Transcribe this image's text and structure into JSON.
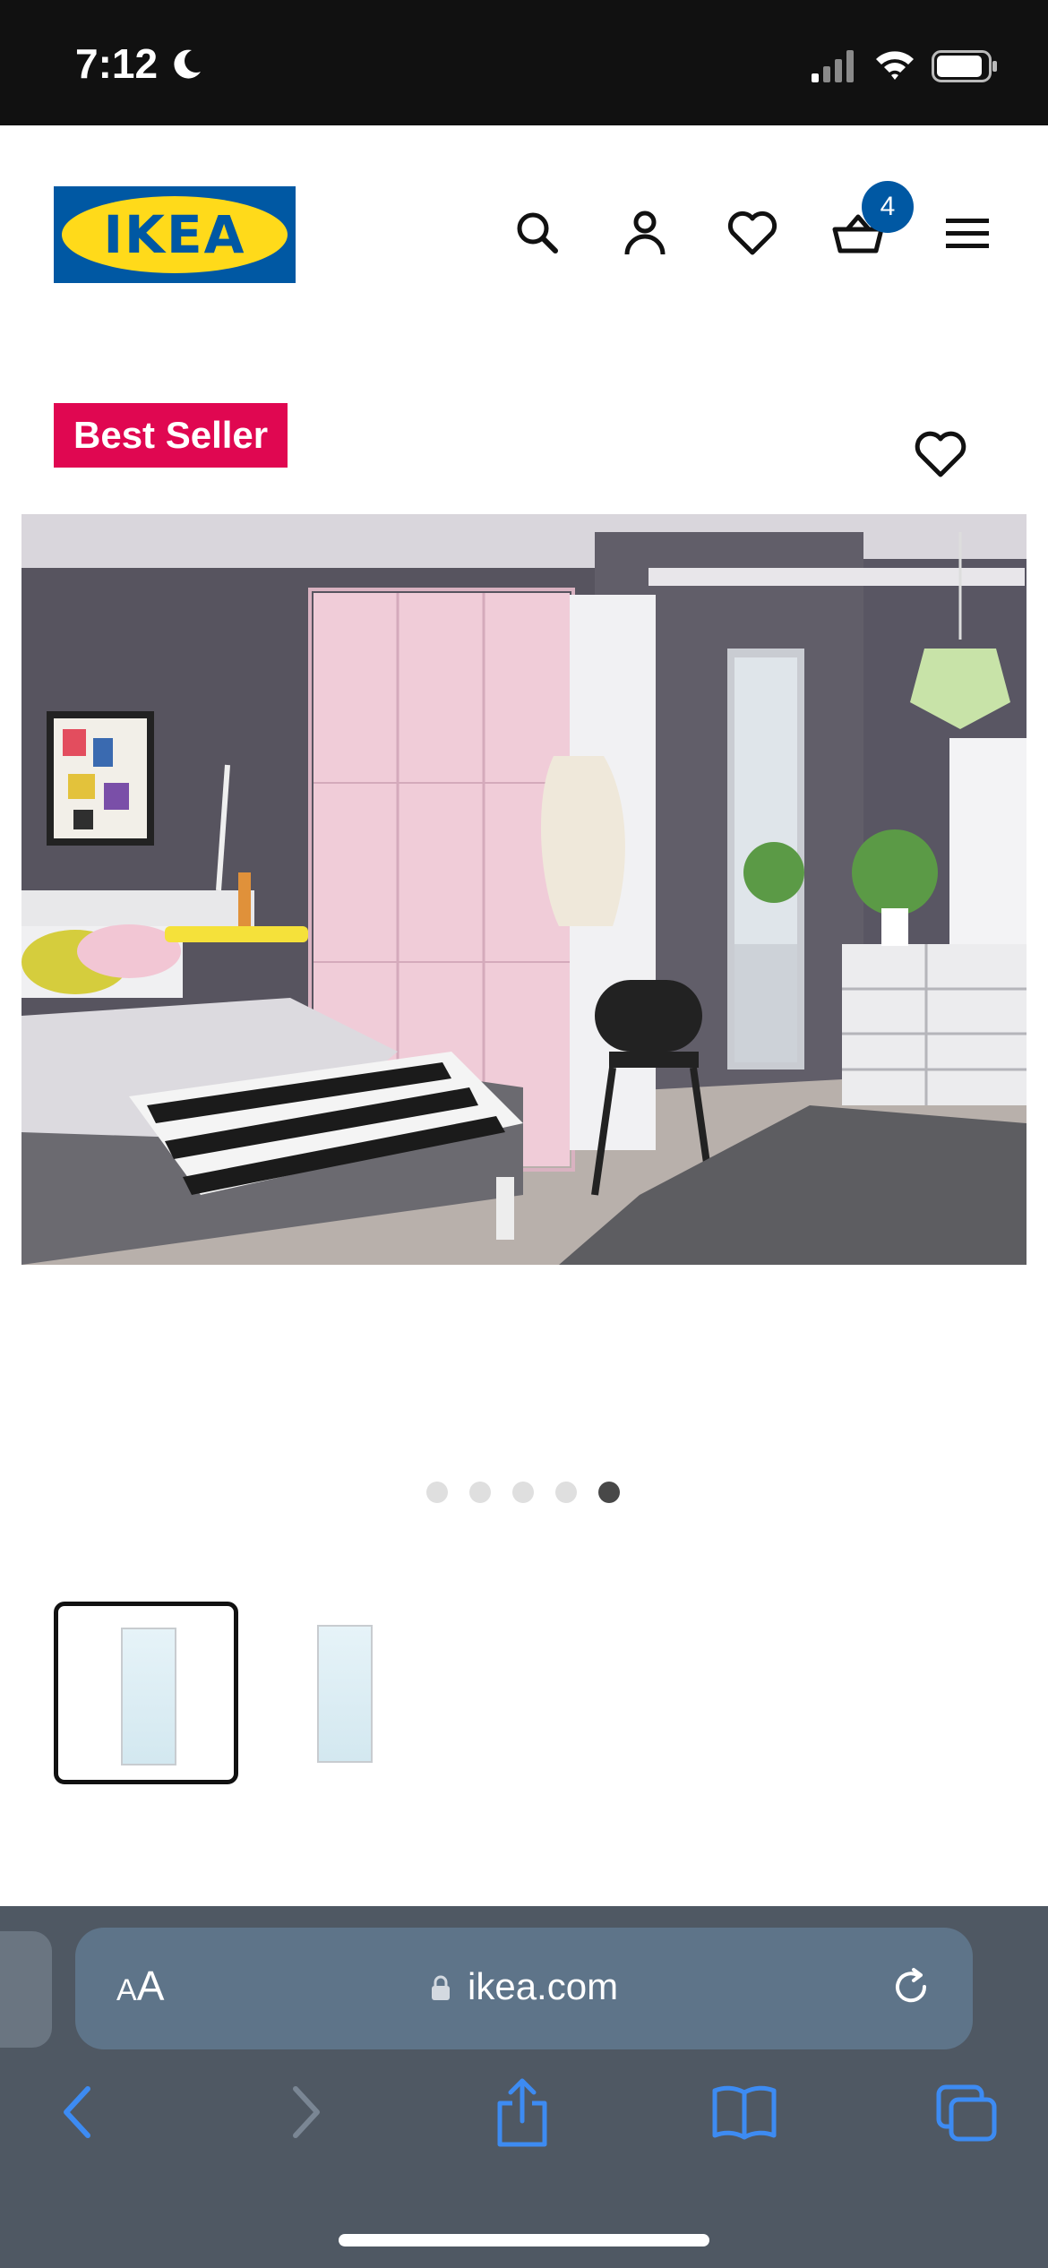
{
  "status_bar": {
    "time": "7:12",
    "icons": [
      "moon-icon",
      "cellular-signal-icon",
      "wifi-icon",
      "battery-icon"
    ]
  },
  "header": {
    "logo_text": "IKEA",
    "cart_count": "4",
    "icons": [
      "search-icon",
      "account-icon",
      "wishlist-heart-icon",
      "cart-basket-icon",
      "hamburger-menu-icon"
    ]
  },
  "product": {
    "badge": "Best Seller",
    "carousel": {
      "total": 5,
      "active_index": 5
    },
    "thumbnails": [
      "mirror-thumbnail-front",
      "mirror-thumbnail-angle"
    ],
    "selected_thumbnail": 1
  },
  "browser": {
    "text_size_label_small": "A",
    "text_size_label_large": "A",
    "url": "ikea.com",
    "toolbar_icons": [
      "back-chevron-icon",
      "forward-chevron-icon",
      "share-icon",
      "bookmarks-book-icon",
      "tabs-icon"
    ]
  },
  "colors": {
    "ikea_blue": "#0058a3",
    "ikea_yellow": "#ffda1a",
    "badge_pink": "#e00751",
    "safari_blue": "#3d8bf2"
  }
}
